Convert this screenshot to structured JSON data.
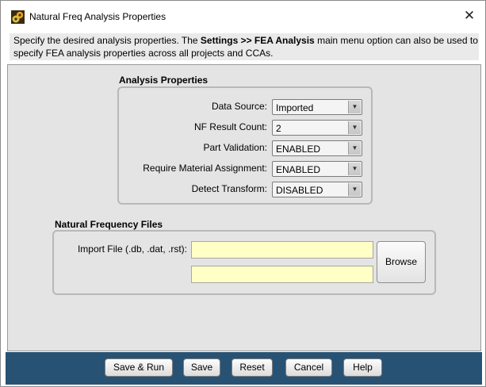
{
  "window": {
    "title": "Natural Freq Analysis Properties",
    "close_symbol": "✕"
  },
  "description": {
    "part1": "Specify the desired analysis properties. The ",
    "emphasis": "Settings >> FEA Analysis",
    "part2": " main menu option can also be used to",
    "line2": "specify FEA analysis properties across all projects and CCAs."
  },
  "analysis_properties": {
    "heading": "Analysis Properties",
    "rows": [
      {
        "label": "Data Source:",
        "value": "Imported"
      },
      {
        "label": "NF Result Count:",
        "value": "2"
      },
      {
        "label": "Part Validation:",
        "value": "ENABLED"
      },
      {
        "label": "Require Material Assignment:",
        "value": "ENABLED"
      },
      {
        "label": "Detect Transform:",
        "value": "DISABLED"
      }
    ]
  },
  "natural_frequency_files": {
    "heading": "Natural Frequency Files",
    "import_label": "Import File (.db, .dat, .rst):",
    "input1_value": "",
    "input2_value": "",
    "browse_label": "Browse"
  },
  "footer": {
    "buttons": {
      "save_run": "Save & Run",
      "save": "Save",
      "reset": "Reset",
      "cancel": "Cancel",
      "help": "Help"
    }
  },
  "icons": {
    "app": "gears-icon",
    "dropdown": "chevron-down-icon"
  },
  "colors": {
    "footer": "#285274",
    "input_bg": "#ffffc6",
    "panel_bg": "#e4e4e4"
  }
}
